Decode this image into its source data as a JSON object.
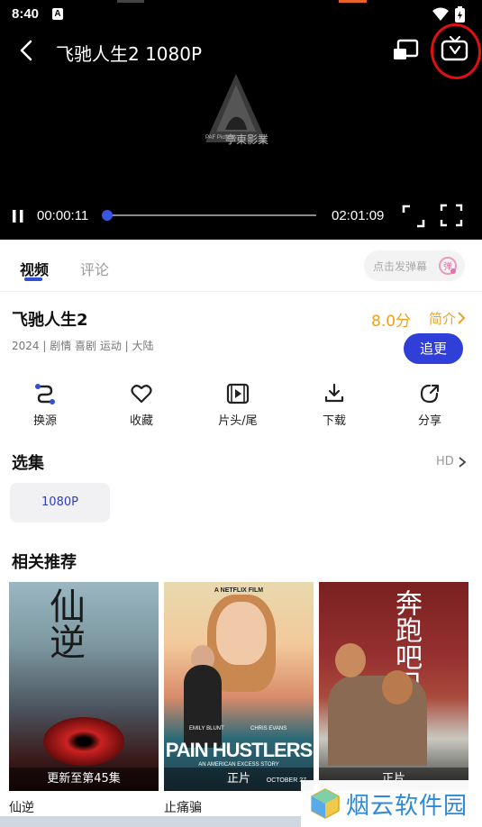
{
  "status_bar": {
    "time": "8:40",
    "notification_icon": "A",
    "wifi_icon": "wifi-icon",
    "battery_icon": "battery-charging-icon"
  },
  "player": {
    "title": "飞驰人生2  1080P",
    "watermark_logo_text": "亭東影業",
    "watermark_logo_small": "PAF Pictures",
    "current_time": "00:00:11",
    "total_time": "02:01:09",
    "progress_fraction": 0.0015,
    "icons": [
      "back-icon",
      "cast-icon",
      "tv-icon",
      "pause-icon",
      "fullscreen-icon",
      "expand-icon"
    ],
    "highlight_color": "#e01010"
  },
  "tabs": {
    "items": [
      "视频",
      "评论"
    ],
    "active_index": 0,
    "danmaku_placeholder": "点击发弹幕",
    "danmaku_icon_text": "弹"
  },
  "movie": {
    "title": "飞驰人生2",
    "rating": "8.0分",
    "intro_label": "简介",
    "meta": "2024 | 剧情 喜剧 运动 | 大陆",
    "follow_label": "追更",
    "accent_color": "#2f3fd8",
    "rating_color": "#f0a020"
  },
  "actions": [
    {
      "label": "换源",
      "icon": "switch-source-icon"
    },
    {
      "label": "收藏",
      "icon": "heart-icon"
    },
    {
      "label": "片头/尾",
      "icon": "skip-intro-icon"
    },
    {
      "label": "下载",
      "icon": "download-icon"
    },
    {
      "label": "分享",
      "icon": "share-icon"
    }
  ],
  "episodes": {
    "title": "选集",
    "quality_link": "HD",
    "items": [
      "1080P"
    ]
  },
  "recommendations": {
    "title": "相关推荐",
    "items": [
      {
        "name": "仙逆",
        "caption": "更新至第45集",
        "poster_text": "仙逆"
      },
      {
        "name": "止痛骗",
        "caption": "正片",
        "poster_header": "A NETFLIX FILM",
        "poster_title": "PAIN HUSTLERS",
        "poster_subtitle": "AN AMERICAN EXCESS STORY",
        "poster_cast_1": "EMILY BLUNT",
        "poster_cast_2": "CHRIS EVANS",
        "poster_date": "OCTOBER 27"
      },
      {
        "name": "",
        "caption": "正片",
        "poster_text": "奔跑吧兄弟"
      }
    ]
  },
  "overlay_watermark": {
    "text": "烟云软件园",
    "color": "#2c8ad8"
  }
}
